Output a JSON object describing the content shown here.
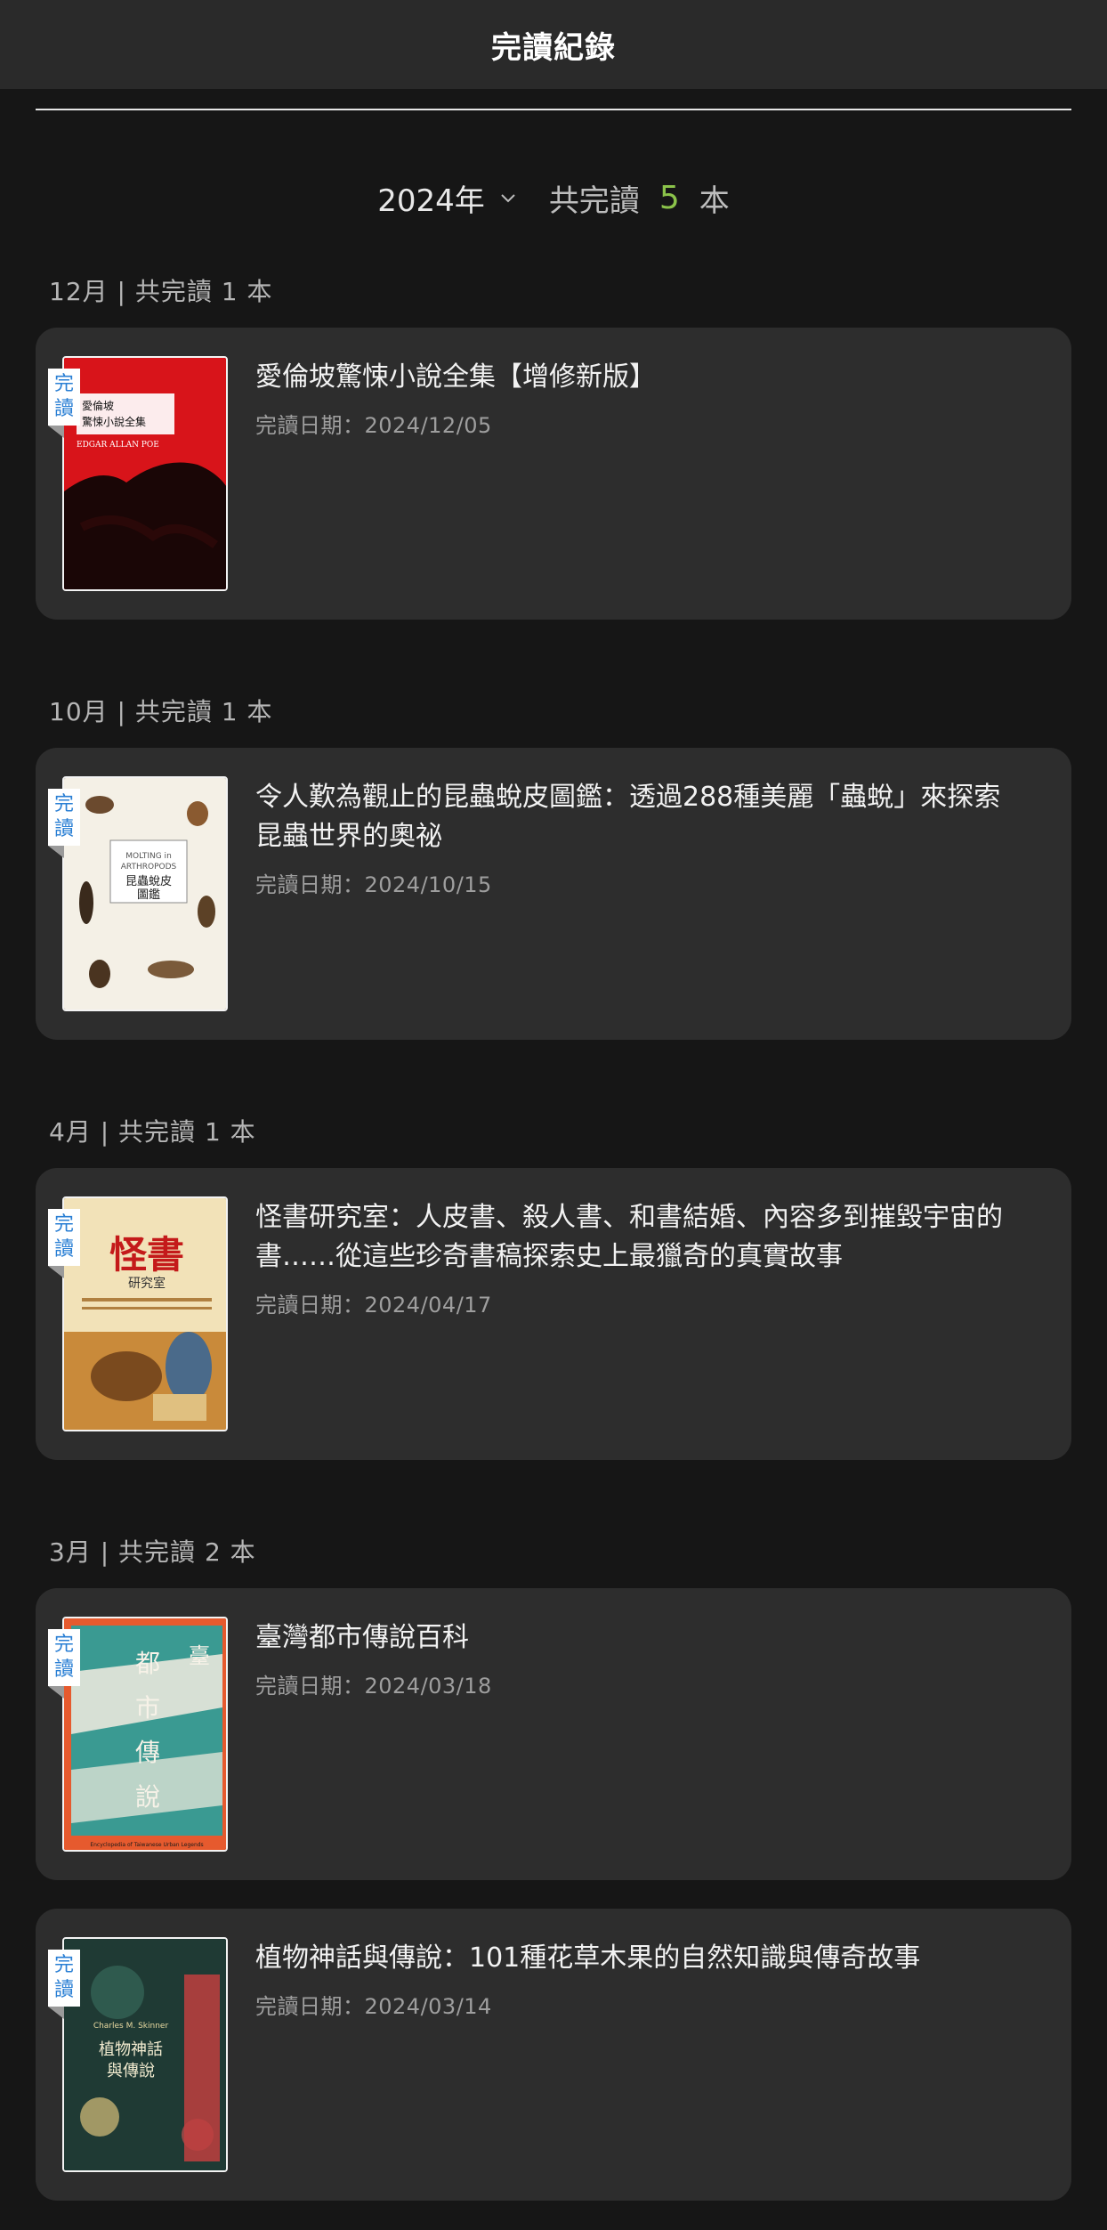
{
  "header": {
    "title": "完讀紀錄"
  },
  "summary": {
    "year": "2024年",
    "total_label": "共完讀",
    "total_count": "5",
    "total_unit": "本"
  },
  "groups": [
    {
      "label": "12月 | 共完讀 1 本",
      "books": [
        {
          "title": "愛倫坡驚悚小說全集【增修新版】",
          "date": "完讀日期：2024/12/05",
          "badge": "完讀",
          "cover_text": "愛倫坡\n驚悚小說全集",
          "cover_sub": "EDGAR ALLAN POE"
        }
      ]
    },
    {
      "label": "10月 | 共完讀 1 本",
      "books": [
        {
          "title": "令人歎為觀止的昆蟲蛻皮圖鑑：透過288種美麗「蟲蛻」來探索昆蟲世界的奧祕",
          "date": "完讀日期：2024/10/15",
          "badge": "完讀",
          "cover_text": "昆蟲蛻皮\n圖鑑",
          "cover_sub": "MOLTING in ARTHROPODS"
        }
      ]
    },
    {
      "label": "4月 | 共完讀 1 本",
      "books": [
        {
          "title": "怪書研究室：人皮書、殺人書、和書結婚、內容多到摧毀宇宙的書……從這些珍奇書稿探索史上最獵奇的真實故事",
          "date": "完讀日期：2024/04/17",
          "badge": "完讀",
          "cover_text": "怪書",
          "cover_sub": "研究室"
        }
      ]
    },
    {
      "label": "3月 | 共完讀 2 本",
      "books": [
        {
          "title": "臺灣都市傳說百科",
          "date": "完讀日期：2024/03/18",
          "badge": "完讀",
          "cover_text": "都市傳說",
          "cover_sub": "Encyclopedia of Taiwanese Urban Legends"
        },
        {
          "title": "植物神話與傳說：101種花草木果的自然知識與傳奇故事",
          "date": "完讀日期：2024/03/14",
          "badge": "完讀",
          "cover_text": "植物神話\n與傳說",
          "cover_sub": "Charles M. Skinner"
        }
      ]
    }
  ],
  "colors": {
    "accent_count": "#8bc34a",
    "badge_text": "#2a7fd4",
    "card_bg": "#2d2d2d",
    "page_bg": "#161616"
  }
}
